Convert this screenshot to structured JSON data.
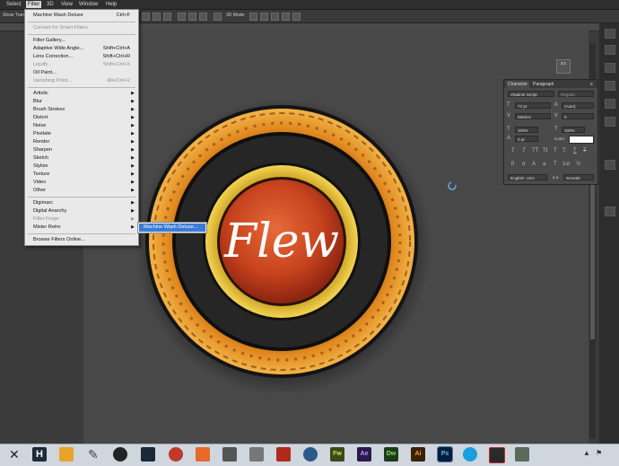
{
  "menubar": {
    "items": [
      "Select",
      "Filter",
      "3D",
      "View",
      "Window",
      "Help"
    ]
  },
  "options_bar": {
    "show_label": "Show Trans",
    "mode_label": "3D Mode:"
  },
  "filter_menu": {
    "last_filter": {
      "label": "Machine Wash Deluxe",
      "shortcut": "Ctrl+F"
    },
    "convert_smart": "Convert for Smart Filters",
    "group1": [
      {
        "label": "Filter Gallery...",
        "shortcut": "",
        "disabled": false
      },
      {
        "label": "Adaptive Wide Angle...",
        "shortcut": "Shift+Ctrl+A",
        "disabled": false
      },
      {
        "label": "Lens Correction...",
        "shortcut": "Shift+Ctrl+R",
        "disabled": false
      },
      {
        "label": "Liquify...",
        "shortcut": "Shift+Ctrl+X",
        "disabled": true
      },
      {
        "label": "Oil Paint...",
        "shortcut": "",
        "disabled": false
      },
      {
        "label": "Vanishing Point...",
        "shortcut": "Alt+Ctrl+V",
        "disabled": true
      }
    ],
    "group2": [
      "Artistic",
      "Blur",
      "Brush Strokes",
      "Distort",
      "Noise",
      "Pixelate",
      "Render",
      "Sharpen",
      "Sketch",
      "Stylize",
      "Texture",
      "Video",
      "Other"
    ],
    "group3": [
      {
        "label": "Digimarc",
        "disabled": false
      },
      {
        "label": "Digital Anarchy",
        "disabled": false
      },
      {
        "label": "Filter Forge",
        "disabled": true
      },
      {
        "label": "Mister Retro",
        "disabled": false
      }
    ],
    "browse": "Browse Filters Online...",
    "submenu_item": "Machine Wash Deluxe..."
  },
  "canvas": {
    "logo_text": "Flew"
  },
  "character_panel": {
    "tabs": [
      "Character",
      "Paragraph"
    ],
    "font_family": "Vladimir Script",
    "font_style": "Regular",
    "font_size": "72 pt",
    "leading": "(Auto)",
    "kerning": "Metrics",
    "tracking": "0",
    "vertical_scale": "100%",
    "horizontal_scale": "100%",
    "baseline_shift": "0 pt",
    "color_label": "Color:",
    "language": "English: USA",
    "aa_label": "a a",
    "antialias": "Smooth",
    "type_styles": [
      "T",
      "T",
      "TT",
      "Tt",
      "T",
      "T,",
      "T",
      "T"
    ]
  },
  "zoom_badge": "3:1",
  "colors": {
    "menu_bg": "#e9e9e9",
    "highlight": "#3a7bd5",
    "outer_ring": "#e0891f",
    "inner_ring": "#e6c43a",
    "center": "#c8431e"
  },
  "taskbar": {
    "icons": [
      "H",
      "Fw",
      "Ae",
      "Dw",
      "Ai",
      "Ps"
    ]
  }
}
